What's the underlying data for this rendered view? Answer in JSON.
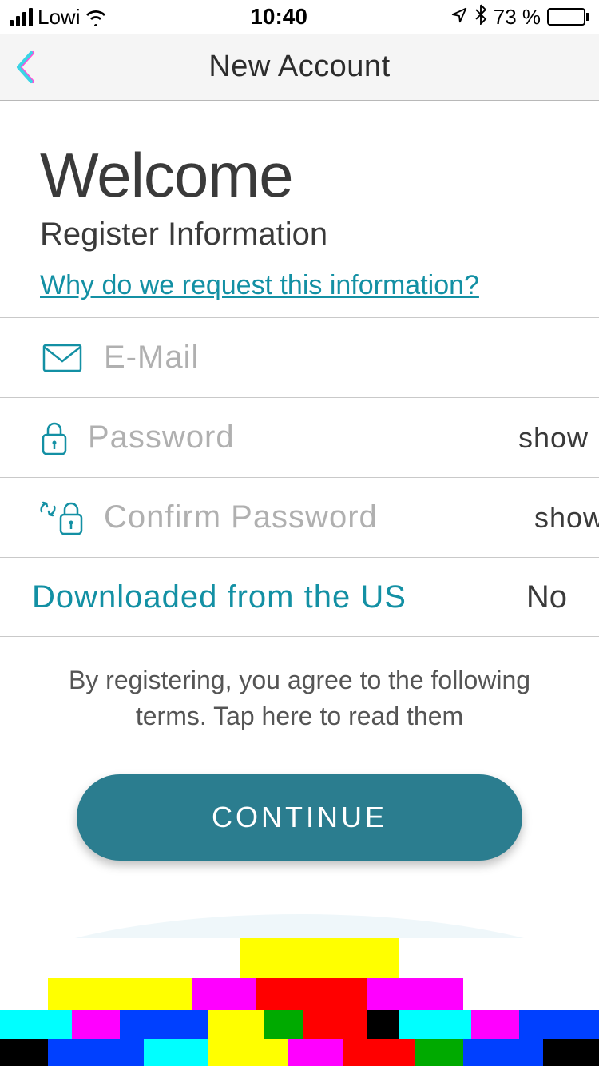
{
  "status": {
    "carrier": "Lowi",
    "time": "10:40",
    "battery_text": "73 %"
  },
  "nav": {
    "title": "New Account"
  },
  "welcome": {
    "title": "Welcome",
    "subtitle": "Register Information",
    "why_link": "Why do we request this information?"
  },
  "fields": {
    "email_placeholder": "E-Mail",
    "password_placeholder": "Password",
    "confirm_placeholder": "Confirm Password",
    "show_label": "show"
  },
  "toggle": {
    "label": "Downloaded from the US",
    "value": "No"
  },
  "terms": "By registering, you agree to the following terms. Tap here to read them",
  "continue_label": "CONTINUE"
}
